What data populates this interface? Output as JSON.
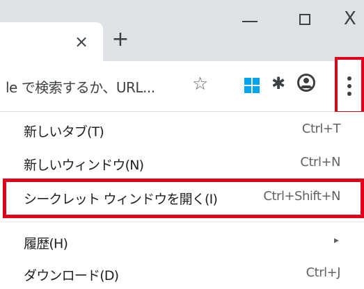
{
  "tabstrip": {
    "close_glyph": "×",
    "new_tab_glyph": "+"
  },
  "window_controls": {
    "close_glyph": "X"
  },
  "toolbar": {
    "omnibox_text": "le で検索するか、URL...",
    "icons": [
      "star-icon",
      "windows-icon",
      "puzzle-icon",
      "profile-icon",
      "kebab-menu-icon"
    ]
  },
  "menu": {
    "items": [
      {
        "label": "新しいタブ(T)",
        "shortcut": "Ctrl+T"
      },
      {
        "label": "新しいウィンドウ(N)",
        "shortcut": "Ctrl+N"
      },
      {
        "label": "シークレット ウィンドウを開く(I)",
        "shortcut": "Ctrl+Shift+N"
      },
      {
        "label": "履歴(H)",
        "shortcut": ""
      },
      {
        "label": "ダウンロード(D)",
        "shortcut": "Ctrl+J"
      }
    ],
    "history_arrow": "▸"
  },
  "colors": {
    "highlight_border": "#e1001a",
    "titlebar": "#dee1e6",
    "windows_logo": "#00a4ef"
  }
}
